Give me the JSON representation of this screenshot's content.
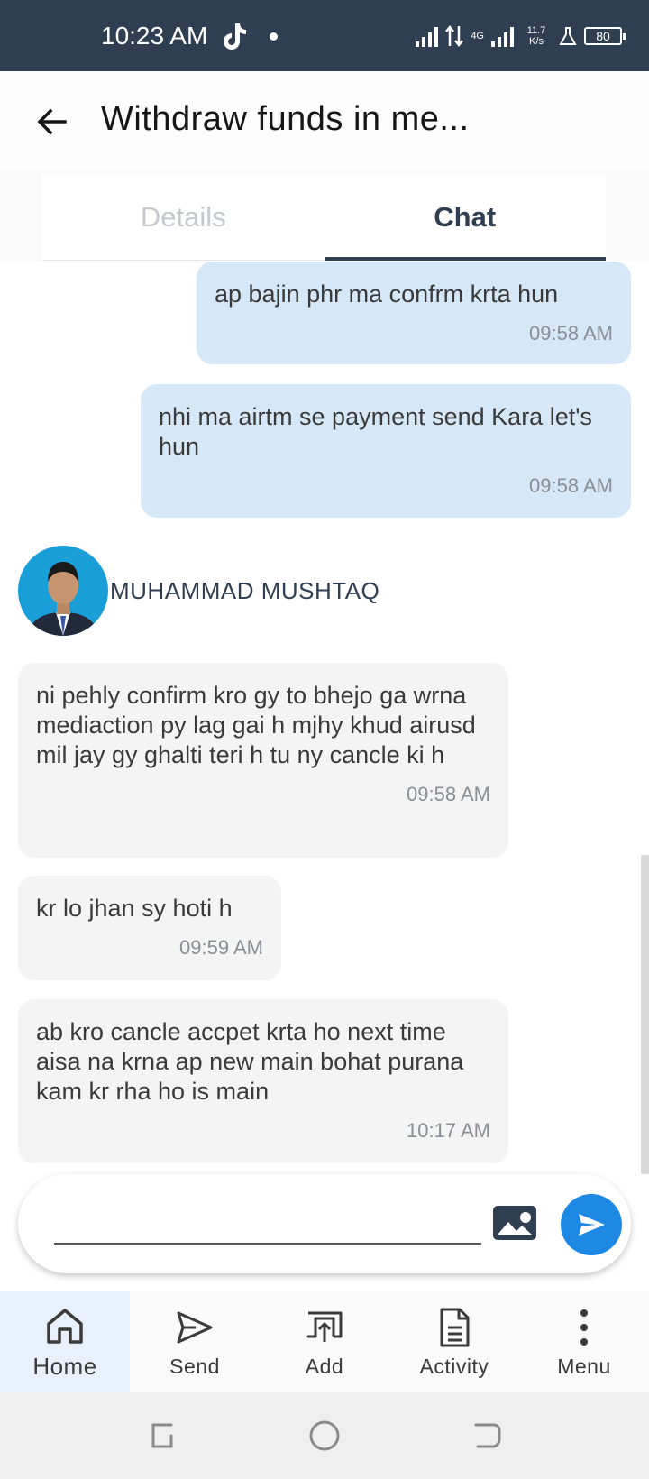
{
  "status_bar": {
    "time": "10:23 AM",
    "network_speed": "11.7 K/s",
    "network_type": "4G",
    "battery": "80"
  },
  "app_bar": {
    "title": "Withdraw funds in me..."
  },
  "tabs": [
    {
      "label": "Details",
      "active": false
    },
    {
      "label": "Chat",
      "active": true
    }
  ],
  "messages": {
    "outgoing": [
      {
        "text": "ap bajin phr ma confrm krta hun",
        "time": "09:58 AM"
      },
      {
        "text": "nhi ma airtm se payment send Kara let's hun",
        "time": "09:58 AM"
      }
    ],
    "sender_name": "MUHAMMAD MUSHTAQ",
    "incoming": [
      {
        "text": "ni pehly confirm kro gy to bhejo ga wrna mediaction py lag gai h mjhy khud airusd mil jay gy ghalti teri h tu ny cancle ki h",
        "time": "09:58 AM"
      },
      {
        "text": "kr lo jhan sy hoti h",
        "time": "09:59 AM"
      },
      {
        "text": "ab kro cancle accpet krta ho next time aisa na krna ap new main bohat purana kam kr rha ho is main",
        "time": "10:17 AM"
      }
    ]
  },
  "composer": {
    "value": "",
    "placeholder": ""
  },
  "bottom_nav": [
    {
      "label": "Home",
      "icon": "home-icon",
      "active": true
    },
    {
      "label": "Send",
      "icon": "send-icon",
      "active": false
    },
    {
      "label": "Add",
      "icon": "add-funds-icon",
      "active": false
    },
    {
      "label": "Activity",
      "icon": "document-icon",
      "active": false
    },
    {
      "label": "Menu",
      "icon": "more-vertical-icon",
      "active": false
    }
  ],
  "colors": {
    "status_bar": "#2f3e50",
    "accent": "#1e88e5",
    "outgoing_bubble": "#d6e8f8",
    "incoming_bubble": "#f4f4f4"
  }
}
